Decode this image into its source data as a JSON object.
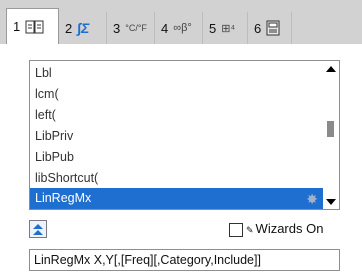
{
  "tabs": [
    {
      "num": "1",
      "icon": "book-icon",
      "active": true
    },
    {
      "num": "2",
      "glyph": "∫Σ",
      "icon": "calculus-icon"
    },
    {
      "num": "3",
      "glyph": "°C/°F",
      "icon": "units-icon"
    },
    {
      "num": "4",
      "glyph": "∞β°",
      "icon": "symbols-icon"
    },
    {
      "num": "5",
      "glyph": "⊞⁴",
      "icon": "templates-icon"
    },
    {
      "num": "6",
      "icon": "library-icon"
    }
  ],
  "catalog": {
    "items": [
      "Lbl",
      "lcm(",
      "left(",
      "LibPriv",
      "LibPub",
      "libShortcut(",
      "LinRegMx"
    ],
    "selected": "LinRegMx"
  },
  "wizards": {
    "label": "Wizards On",
    "checked": false
  },
  "syntax": "LinRegMx X,Y[,[Freq][,Category,Include]]",
  "colors": {
    "selection": "#1f6fd0",
    "tabbar": "#d2d2d2"
  }
}
